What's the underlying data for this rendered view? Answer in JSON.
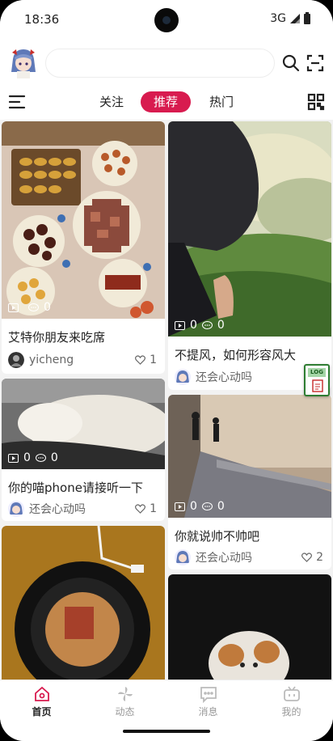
{
  "status_bar": {
    "time": "18:36",
    "network": "3G"
  },
  "header": {
    "search": {
      "placeholder": "",
      "value": ""
    }
  },
  "tabs": [
    {
      "label": "关注",
      "active": false
    },
    {
      "label": "推荐",
      "active": true
    },
    {
      "label": "热门",
      "active": false
    }
  ],
  "feed": {
    "cards": [
      {
        "title": "艾特你朋友来吃席",
        "author": "yicheng",
        "likes": "1",
        "plays": "",
        "comments": "0"
      },
      {
        "title": "不提风，如何形容风大",
        "author": "还会心动吗",
        "likes": "",
        "plays": "0",
        "comments": "0"
      },
      {
        "title": "你的喵phone请接听一下",
        "author": "还会心动吗",
        "likes": "1",
        "plays": "0",
        "comments": "0"
      },
      {
        "title": "你就说帅不帅吧",
        "author": "还会心动吗",
        "likes": "2",
        "plays": "0",
        "comments": "0"
      },
      {
        "title": "",
        "author": "",
        "likes": "",
        "plays": "",
        "comments": ""
      },
      {
        "title": "",
        "author": "",
        "likes": "",
        "plays": "",
        "comments": ""
      }
    ],
    "log_badge": "LOG"
  },
  "bottom_nav": [
    {
      "label": "首页",
      "icon": "home-icon",
      "active": true
    },
    {
      "label": "动态",
      "icon": "pinwheel-icon",
      "active": false
    },
    {
      "label": "消息",
      "icon": "message-icon",
      "active": false
    },
    {
      "label": "我的",
      "icon": "tv-icon",
      "active": false
    }
  ],
  "colors": {
    "accent": "#d81b4f",
    "background": "#f2f2f2"
  }
}
